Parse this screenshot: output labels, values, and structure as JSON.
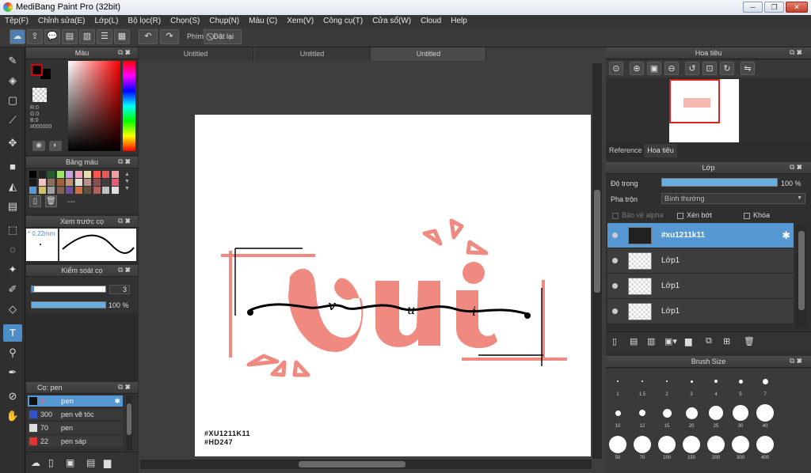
{
  "app": {
    "title": "MediBang Paint Pro (32bit)",
    "window_controls": [
      "minimize",
      "restore",
      "close"
    ]
  },
  "menu": [
    "Tệp(F)",
    "Chỉnh sửa(E)",
    "Lớp(L)",
    "Bộ lọc(R)",
    "Chọn(S)",
    "Chụp(N)",
    "Màu (C)",
    "Xem(V)",
    "Công cụ(T)",
    "Cửa sổ(W)",
    "Cloud",
    "Help"
  ],
  "toolbar": {
    "phim_label": "Phím",
    "reset_label": "Đặt lại"
  },
  "color_panel": {
    "title": "Màu",
    "r": "R:0",
    "g": "G:0",
    "b": "B:0",
    "hex": "#000000",
    "fg": "#cc0000",
    "bg": "#000000"
  },
  "palette_panel": {
    "title": "Bảng màu",
    "dash": "---",
    "colors": [
      "#000000",
      "#222222",
      "#2a5a30",
      "#9be66b",
      "#c9a0e8",
      "#f4a0b8",
      "#e8e0b0",
      "#ff5555",
      "#e85858",
      "#f0a0a0",
      "#1a1a1a",
      "#f4c0c0",
      "#8a7060",
      "#a06040",
      "#c09070",
      "#e0e0d0",
      "#b89090",
      "#885050",
      "#404040",
      "#e85a78",
      "#5a9ad0",
      "#d0c060",
      "#a0a0a0",
      "#806050",
      "#7050a0",
      "#d07040",
      "#605040",
      "#b06060",
      "#c0c0c0",
      "#e0e0e0"
    ]
  },
  "preview_panel": {
    "title": "Xem trước cọ",
    "size": "0.22mm"
  },
  "brush_control": {
    "title": "Kiểm soát cọ",
    "size_value": "3",
    "opacity_value": "100 %",
    "opacity_fraction": 1.0
  },
  "brush_list": {
    "title": "Cọ: pen",
    "items": [
      {
        "size": "3",
        "name": "pen",
        "color": "#111111",
        "selected": true
      },
      {
        "size": "300",
        "name": "pen vẽ tóc",
        "color": "#3355cc",
        "selected": false
      },
      {
        "size": "70",
        "name": "pen",
        "color": "#dddddd",
        "selected": false
      },
      {
        "size": "22",
        "name": "pen sáp",
        "color": "#dd3333",
        "selected": false
      }
    ]
  },
  "documents": {
    "tabs": [
      "Untitled",
      "Untitled",
      "Untitled"
    ],
    "active_index": 2
  },
  "canvas": {
    "watermark_line1": "#XU1211K11",
    "watermark_line2": "#HD247",
    "artwork": "Vui",
    "bar_letters": [
      "v",
      "u",
      "i"
    ],
    "salmon": "#f08a80"
  },
  "navigator": {
    "title": "Hoa tiêu",
    "tabs": [
      "Reference",
      "Hoa tiêu"
    ]
  },
  "layers": {
    "title": "Lớp",
    "opacity_label": "Độ trong",
    "opacity_value": "100 %",
    "opacity_fraction": 1.0,
    "blend_label": "Pha trộn",
    "blend_value": "Bình thường",
    "protect_alpha": "Bảo vệ alpha",
    "clipping": "Xén bớt",
    "lock": "Khóa",
    "items": [
      {
        "name": "#xu1211k11",
        "selected": true
      },
      {
        "name": "Lớp1",
        "selected": false
      },
      {
        "name": "Lớp1",
        "selected": false
      },
      {
        "name": "Lớp1",
        "selected": false
      }
    ]
  },
  "brush_size": {
    "title": "Brush Size",
    "row1": [
      "1",
      "1.5",
      "2",
      "3",
      "4",
      "5",
      "7"
    ],
    "row2": [
      "10",
      "12",
      "15",
      "20",
      "25",
      "30",
      "40"
    ],
    "row3": [
      "50",
      "70",
      "100",
      "150",
      "200",
      "300",
      "400"
    ]
  }
}
